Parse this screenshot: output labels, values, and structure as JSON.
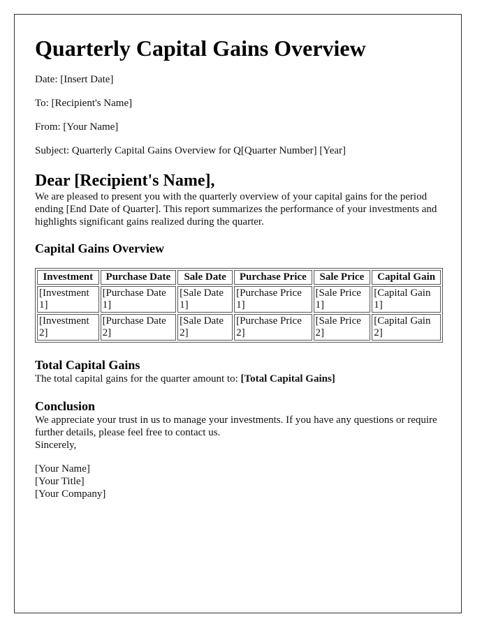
{
  "document": {
    "title": "Quarterly Capital Gains Overview",
    "meta": {
      "date": "Date: [Insert Date]",
      "to": "To: [Recipient's Name]",
      "from": "From: [Your Name]",
      "subject": "Subject: Quarterly Capital Gains Overview for Q[Quarter Number] [Year]"
    },
    "salutation": "Dear [Recipient's Name],",
    "intro": "We are pleased to present you with the quarterly overview of your capital gains for the period ending [End Date of Quarter]. This report summarizes the performance of your investments and highlights significant gains realized during the quarter.",
    "overview_heading": "Capital Gains Overview",
    "table": {
      "headers": [
        "Investment",
        "Purchase Date",
        "Sale Date",
        "Purchase Price",
        "Sale Price",
        "Capital Gain"
      ],
      "rows": [
        [
          "[Investment 1]",
          "[Purchase Date 1]",
          "[Sale Date 1]",
          "[Purchase Price 1]",
          "[Sale Price 1]",
          "[Capital Gain 1]"
        ],
        [
          "[Investment 2]",
          "[Purchase Date 2]",
          "[Sale Date 2]",
          "[Purchase Price 2]",
          "[Sale Price 2]",
          "[Capital Gain 2]"
        ]
      ]
    },
    "total_heading": "Total Capital Gains",
    "total_text": "The total capital gains for the quarter amount to: ",
    "total_value": "[Total Capital Gains]",
    "conclusion_heading": "Conclusion",
    "conclusion_text": "We appreciate your trust in us to manage your investments. If you have any questions or require further details, please feel free to contact us.",
    "closing": "Sincerely,",
    "signature": {
      "name": "[Your Name]",
      "title": "[Your Title]",
      "company": "[Your Company]"
    }
  }
}
